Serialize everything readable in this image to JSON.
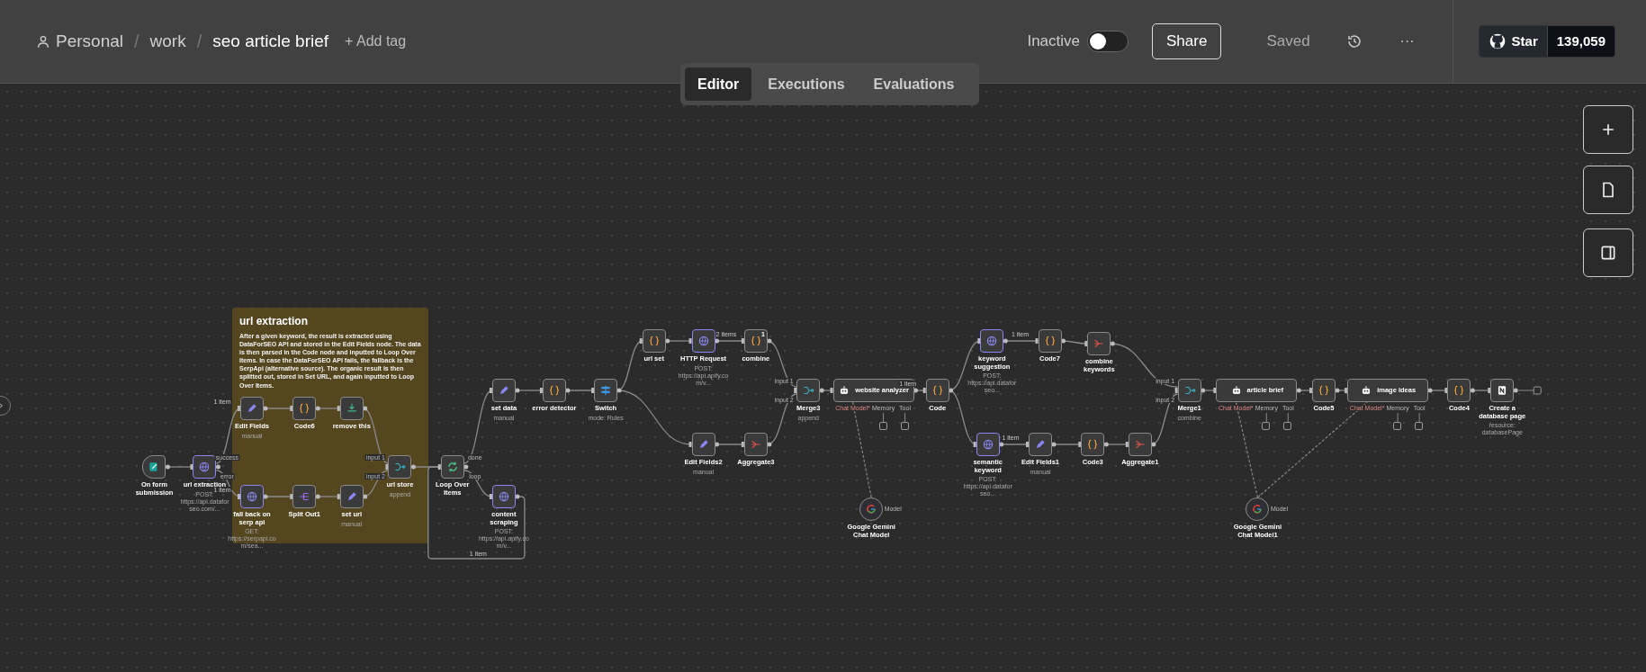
{
  "header": {
    "breadcrumbs": [
      "Personal",
      "work"
    ],
    "separators": [
      "/",
      "/"
    ],
    "title": "seo article brief",
    "add_tag": "+ Add tag",
    "status_label": "Inactive",
    "active": false,
    "share": "Share",
    "saved": "Saved",
    "more": "···",
    "github": {
      "label": "Star",
      "count": "139,059"
    }
  },
  "tabs": [
    {
      "label": "Editor",
      "selected": true
    },
    {
      "label": "Executions",
      "selected": false
    },
    {
      "label": "Evaluations",
      "selected": false
    }
  ],
  "sticky": {
    "title": "url extraction",
    "text": "After a given keyword, the result is extracted using DataForSEO API and stored in the Edit Fields node. The data is then parsed in the Code node and inputted to Loop Over Items. In case the DataForSEO API fails, the fallback is the SerpApi (alternative source). The organic result is then splitted out, stored in Set URL, and again inputted to Loop Over Items."
  },
  "nodes": [
    {
      "name": "On form submission",
      "kind": "trigger"
    },
    {
      "name": "url extraction",
      "kind": "http",
      "subtitle": "POST: https://api.dataforseo.com/...",
      "outputs": [
        "success",
        "error"
      ]
    },
    {
      "name": "Edit Fields",
      "kind": "set",
      "subtitle": "manual"
    },
    {
      "name": "Code6",
      "kind": "code"
    },
    {
      "name": "remove this",
      "kind": "filter"
    },
    {
      "name": "fall back on serp api",
      "kind": "http",
      "subtitle": "GET: https://serpapi.com/sea..."
    },
    {
      "name": "Split Out1",
      "kind": "split"
    },
    {
      "name": "set url",
      "kind": "set",
      "subtitle": "manual"
    },
    {
      "name": "url store",
      "kind": "merge",
      "subtitle": "append",
      "inputs": [
        "input 1",
        "input 2"
      ]
    },
    {
      "name": "Loop Over Items",
      "kind": "loop",
      "outputs": [
        "done",
        "loop"
      ]
    },
    {
      "name": "set data",
      "kind": "set",
      "subtitle": "manual"
    },
    {
      "name": "content scraping",
      "kind": "http",
      "subtitle": "POST: https://api.apify.com/v..."
    },
    {
      "name": "error detector",
      "kind": "code"
    },
    {
      "name": "Switch",
      "kind": "switch",
      "subtitle": "mode: Rules"
    },
    {
      "name": "url set",
      "kind": "code"
    },
    {
      "name": "HTTP Request",
      "kind": "http",
      "subtitle": "POST: https://api.apify.com/v..."
    },
    {
      "name": "combine",
      "kind": "code",
      "badge": "1"
    },
    {
      "name": "Edit Fields2",
      "kind": "set",
      "subtitle": "manual"
    },
    {
      "name": "Aggregate3",
      "kind": "aggregate"
    },
    {
      "name": "Merge3",
      "kind": "merge",
      "subtitle": "append",
      "inputs": [
        "input 1",
        "input 2"
      ]
    },
    {
      "name": "website analyzer",
      "kind": "agent",
      "ports": [
        "Chat Model*",
        "Memory",
        "Tool"
      ]
    },
    {
      "name": "Google Gemini Chat Model",
      "kind": "model",
      "ports": [
        "Model"
      ]
    },
    {
      "name": "Code",
      "kind": "code"
    },
    {
      "name": "keyword suggestion",
      "kind": "http",
      "subtitle": "POST: https://api.dataforseo..."
    },
    {
      "name": "Code7",
      "kind": "code"
    },
    {
      "name": "combine keywords",
      "kind": "aggregate"
    },
    {
      "name": "semantic keyword",
      "kind": "http",
      "subtitle": "POST: https://api.dataforseo..."
    },
    {
      "name": "Edit Fields1",
      "kind": "set",
      "subtitle": "manual"
    },
    {
      "name": "Code3",
      "kind": "code"
    },
    {
      "name": "Aggregate1",
      "kind": "aggregate"
    },
    {
      "name": "Merge1",
      "kind": "merge",
      "subtitle": "combine",
      "inputs": [
        "input 1",
        "input 2"
      ]
    },
    {
      "name": "article brief",
      "kind": "agent",
      "ports": [
        "Chat Model*",
        "Memory",
        "Tool"
      ]
    },
    {
      "name": "Google Gemini Chat Model1",
      "kind": "model",
      "ports": [
        "Model"
      ]
    },
    {
      "name": "Code5",
      "kind": "code"
    },
    {
      "name": "image ideas",
      "kind": "agent",
      "ports": [
        "Chat Model*",
        "Memory",
        "Tool"
      ]
    },
    {
      "name": "Code4",
      "kind": "code"
    },
    {
      "name": "Create a database page",
      "kind": "notion",
      "subtitle": "resource: databasePage"
    }
  ],
  "edge_labels": [
    "1 item",
    "1 item",
    "1 item",
    "2 items",
    "1 item",
    "1 item",
    "1 item"
  ]
}
